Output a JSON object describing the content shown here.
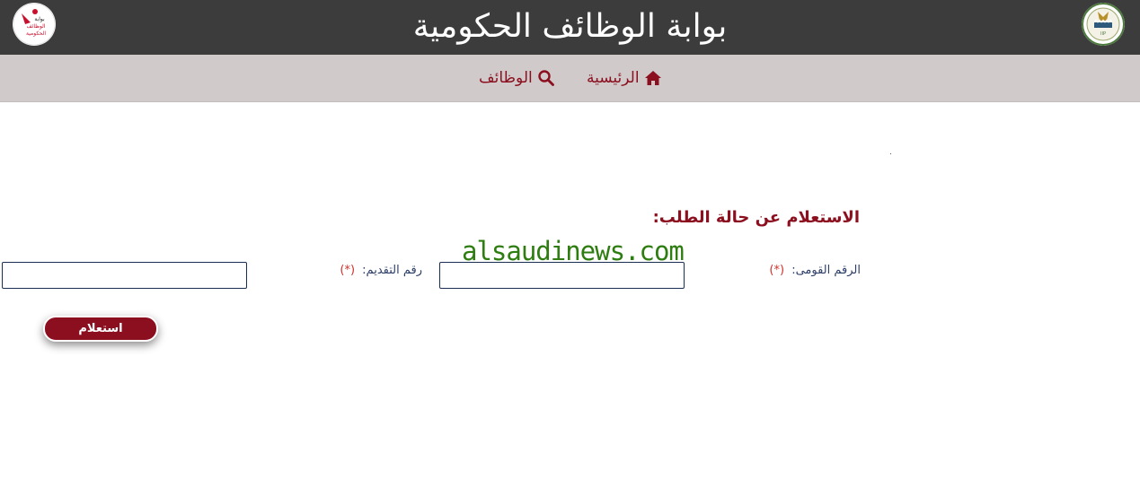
{
  "header": {
    "title": "بوابة الوظائف الحكومية",
    "left_logo_text": [
      "بوابة",
      "الوظائف",
      "الحكومية"
    ],
    "right_logo_text": "IIP",
    "colors": {
      "bg": "#3c3c3c",
      "accent": "#8b0f1e"
    }
  },
  "nav": {
    "items": [
      {
        "label": "الرئيسية",
        "icon": "home-icon"
      },
      {
        "label": "الوظائف",
        "icon": "search-icon"
      }
    ]
  },
  "form": {
    "title": "الاستعلام عن حالة الطلب:",
    "national_id": {
      "label": "الرقم القومى:",
      "required": "(*)",
      "value": ""
    },
    "application_no": {
      "label": "رقم التقديم:",
      "required": "(*)",
      "value": ""
    },
    "submit_label": "استعلام"
  },
  "watermark": "alsaudinews.com"
}
